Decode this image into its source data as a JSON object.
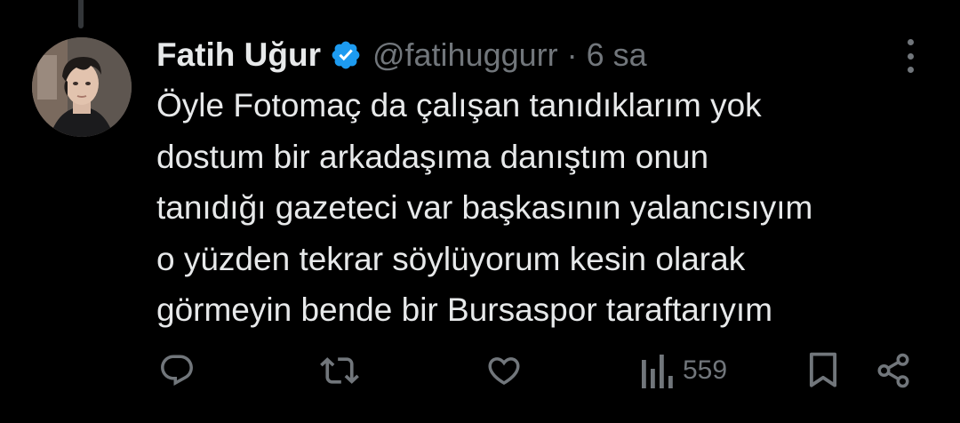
{
  "tweet": {
    "author_name": "Fatih Uğur",
    "handle": "@fatihuggurr",
    "separator": "·",
    "time": "6 sa",
    "verified": true,
    "text_lines": [
      "Öyle Fotomaç da çalışan tanıdıklarım yok",
      "dostum bir arkadaşıma danıştım onun",
      "tanıdığı gazeteci var başkasının yalancısıyım",
      "o yüzden tekrar söylüyorum kesin olarak",
      "görmeyin bende bir Bursaspor taraftarıyım"
    ],
    "views": "559"
  },
  "icons": {
    "verified": "verified-badge-icon",
    "more": "more-options-icon",
    "reply": "reply-icon",
    "retweet": "retweet-icon",
    "like": "like-icon",
    "views": "views-icon",
    "bookmark": "bookmark-icon",
    "share": "share-icon"
  },
  "colors": {
    "background": "#000000",
    "text_primary": "#e7e9ea",
    "text_secondary": "#71767b",
    "verified_blue": "#1d9bf0",
    "thread_line": "#333639"
  }
}
